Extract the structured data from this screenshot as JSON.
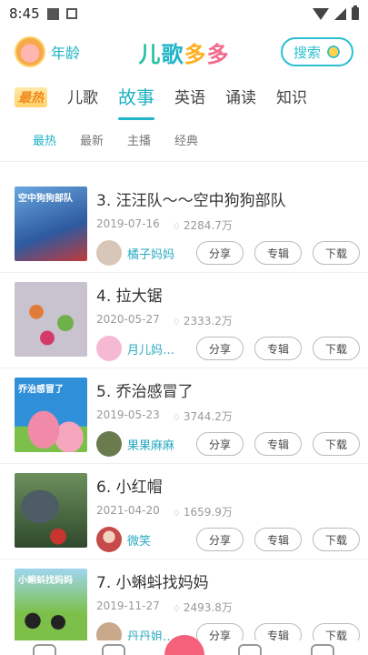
{
  "status": {
    "time": "8:45"
  },
  "header": {
    "age_label": "年龄",
    "title_chars": [
      "儿",
      "歌",
      "多",
      "多"
    ],
    "search_label": "搜索"
  },
  "tabs": [
    {
      "label": "最热"
    },
    {
      "label": "儿歌"
    },
    {
      "label": "故事"
    },
    {
      "label": "英语"
    },
    {
      "label": "诵读"
    },
    {
      "label": "知识"
    }
  ],
  "active_tab": "故事",
  "subtabs": [
    {
      "label": "最热"
    },
    {
      "label": "最新"
    },
    {
      "label": "主播"
    },
    {
      "label": "经典"
    }
  ],
  "actions": {
    "share": "分享",
    "album": "专辑",
    "download": "下载"
  },
  "items": [
    {
      "title": "3. 汪汪队～～空中狗狗部队",
      "date": "2019-07-16",
      "plays": "2284.7万",
      "uploader": "橘子妈妈",
      "thumb_text": "空中狗狗部队",
      "thumb_color": "#4a7fc6",
      "avatar_color": "#d8c7b8"
    },
    {
      "title": "4. 拉大锯",
      "date": "2020-05-27",
      "plays": "2333.2万",
      "uploader": "月儿妈妈...",
      "thumb_text": "",
      "thumb_color": "#c9b6c4",
      "avatar_color": "#f6b9d3"
    },
    {
      "title": "5. 乔治感冒了",
      "date": "2019-05-23",
      "plays": "3744.2万",
      "uploader": "果果麻麻",
      "thumb_text": "乔治感冒了",
      "thumb_color": "#2f8fd8",
      "avatar_color": "#6a7b4e"
    },
    {
      "title": "6. 小红帽",
      "date": "2021-04-20",
      "plays": "1659.9万",
      "uploader": "微笑",
      "thumb_text": "",
      "thumb_color": "#3e5f3a",
      "avatar_color": "#c64a4a"
    },
    {
      "title": "7. 小蝌蚪找妈妈",
      "date": "2019-11-27",
      "plays": "2493.8万",
      "uploader": "丹丹姐姐讲故事",
      "thumb_text": "小蝌蚪找妈妈",
      "thumb_color": "#7cc04a",
      "avatar_color": "#caa88a"
    }
  ]
}
